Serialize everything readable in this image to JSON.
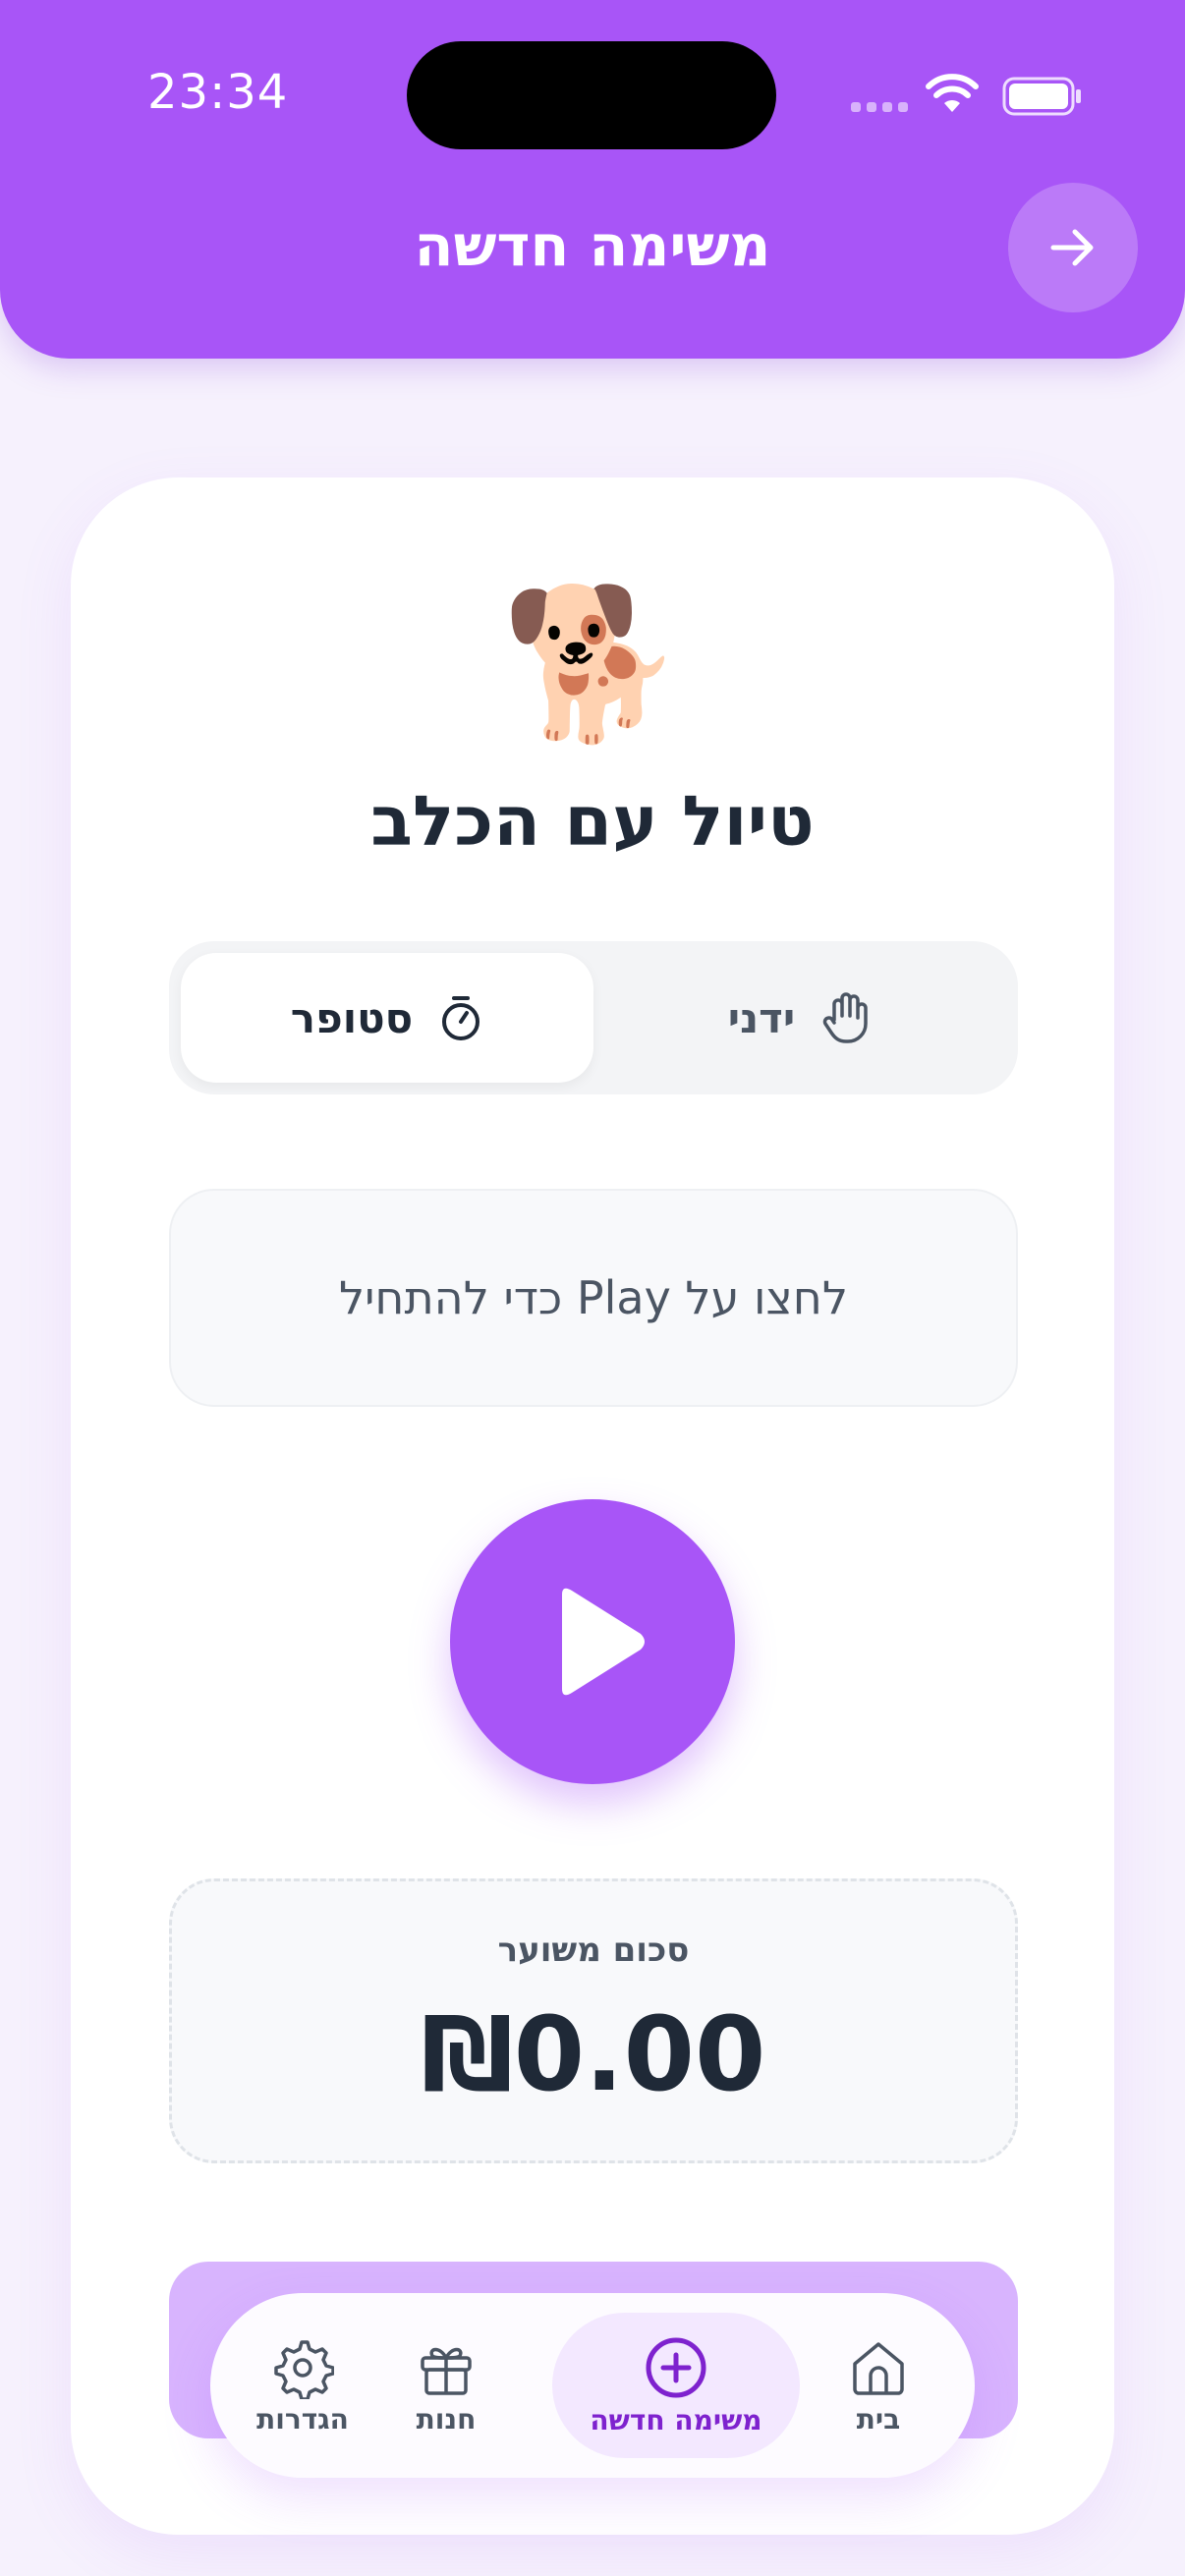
{
  "status_bar": {
    "time": "23:34"
  },
  "header": {
    "title": "משימה חדשה",
    "back_icon": "arrow-right-icon"
  },
  "task": {
    "emoji": "🐕",
    "title": "טיול עם הכלב"
  },
  "mode_toggle": {
    "options": [
      {
        "label": "סטופר",
        "icon": "stopwatch-icon",
        "selected": true
      },
      {
        "label": "ידני",
        "icon": "hand-icon",
        "selected": false
      }
    ]
  },
  "hint": {
    "text": "לחצו על Play כדי להתחיל"
  },
  "play_button": {
    "icon": "play-icon"
  },
  "estimate": {
    "label": "סכום משוער",
    "value": "₪0.00"
  },
  "tab_bar": {
    "items": [
      {
        "label": "הגדרות",
        "icon": "gear-icon",
        "active": false
      },
      {
        "label": "חנות",
        "icon": "gift-icon",
        "active": false
      },
      {
        "label": "משימה חדשה",
        "icon": "plus-circle-icon",
        "active": true
      },
      {
        "label": "בית",
        "icon": "home-icon",
        "active": false
      }
    ]
  },
  "colors": {
    "accent": "#a855f7",
    "accent_light": "#d8b4fe",
    "text_dark": "#1f2937",
    "text_muted": "#4b5563",
    "background": "#f6f1fd"
  }
}
